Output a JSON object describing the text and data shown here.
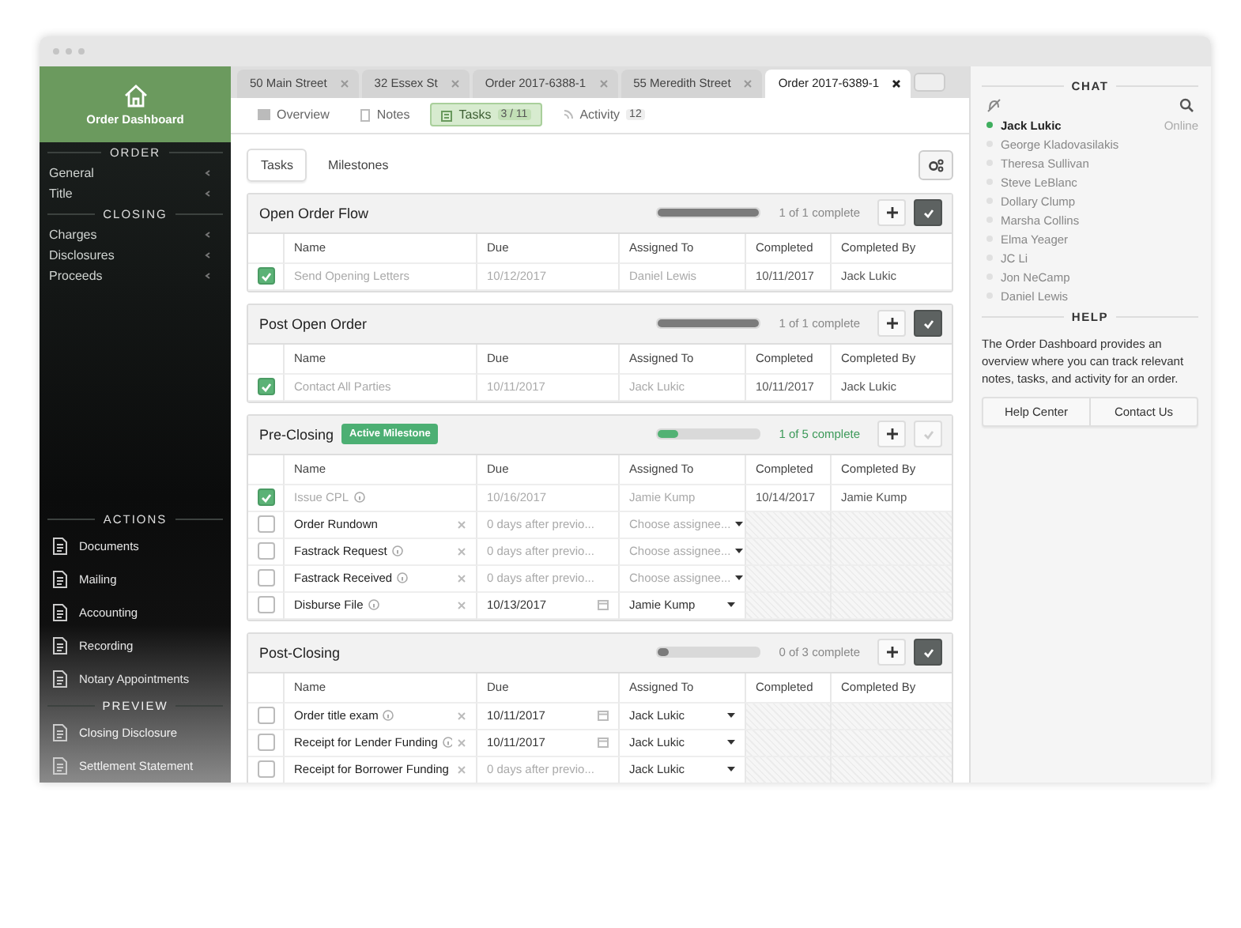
{
  "sidebar": {
    "title": "Order Dashboard",
    "groups": [
      {
        "heading": "ORDER",
        "items": [
          {
            "label": "General"
          },
          {
            "label": "Title"
          }
        ]
      },
      {
        "heading": "CLOSING",
        "items": [
          {
            "label": "Charges"
          },
          {
            "label": "Disclosures"
          },
          {
            "label": "Proceeds"
          }
        ]
      }
    ],
    "actions_heading": "ACTIONS",
    "actions": [
      {
        "label": "Documents"
      },
      {
        "label": "Mailing"
      },
      {
        "label": "Accounting"
      },
      {
        "label": "Recording"
      },
      {
        "label": "Notary Appointments"
      }
    ],
    "preview_heading": "PREVIEW",
    "preview": [
      {
        "label": "Closing Disclosure"
      },
      {
        "label": "Settlement Statement"
      }
    ]
  },
  "tabs": [
    {
      "label": "50 Main Street",
      "selected": false
    },
    {
      "label": "32 Essex St",
      "selected": false
    },
    {
      "label": "Order 2017-6388-1",
      "selected": false
    },
    {
      "label": "55 Meredith Street",
      "selected": false
    },
    {
      "label": "Order 2017-6389-1",
      "selected": true
    }
  ],
  "subtabs": [
    {
      "label": "Overview",
      "selected": false
    },
    {
      "label": "Notes",
      "selected": false
    },
    {
      "label": "Tasks",
      "count": "3 / 11",
      "selected": true
    },
    {
      "label": "Activity",
      "count": "12",
      "selected": false
    }
  ],
  "view_toggle": [
    {
      "label": "Tasks",
      "selected": true
    },
    {
      "label": "Milestones",
      "selected": false
    }
  ],
  "sections": [
    {
      "title": "Open Order Flow",
      "active": false,
      "level": 1,
      "progress_text": "1 of 1 complete",
      "check_enabled": true,
      "columns": [
        "Name",
        "Due",
        "Assigned To",
        "Completed",
        "Completed By"
      ],
      "rows": [
        {
          "kind": "done",
          "checked": true,
          "name": "Send Opening Letters",
          "info": false,
          "due": "10/12/2017",
          "assigned": "Daniel Lewis",
          "completed": "10/11/2017",
          "completed_by": "Jack Lukic"
        }
      ]
    },
    {
      "title": "Post Open Order",
      "active": false,
      "level": 1,
      "progress_text": "1 of 1 complete",
      "check_enabled": true,
      "columns": [
        "Name",
        "Due",
        "Assigned To",
        "Completed",
        "Completed By"
      ],
      "rows": [
        {
          "kind": "done",
          "checked": true,
          "name": "Contact All Parties",
          "info": false,
          "due": "10/11/2017",
          "assigned": "Jack Lukic",
          "completed": "10/11/2017",
          "completed_by": "Jack Lukic"
        }
      ]
    },
    {
      "title": "Pre-Closing",
      "badge": "Active Milestone",
      "active": true,
      "level": 0.2,
      "progress_text": "1 of 5 complete",
      "check_enabled": false,
      "columns": [
        "Name",
        "Due",
        "Assigned To",
        "Completed",
        "Completed By"
      ],
      "rows": [
        {
          "kind": "done",
          "checked": true,
          "name": "Issue CPL",
          "info": true,
          "due": "10/16/2017",
          "assigned": "Jamie Kump",
          "completed": "10/14/2017",
          "completed_by": "Jamie Kump"
        },
        {
          "kind": "edit",
          "checked": false,
          "name": "Order Rundown",
          "info": false,
          "due": {
            "placeholder": "0 days after previo..."
          },
          "assigned": {
            "placeholder": "Choose assignee..."
          }
        },
        {
          "kind": "edit",
          "checked": false,
          "name": "Fastrack Request",
          "info": true,
          "due": {
            "placeholder": "0 days after previo..."
          },
          "assigned": {
            "placeholder": "Choose assignee..."
          }
        },
        {
          "kind": "edit",
          "checked": false,
          "name": "Fastrack Received",
          "info": true,
          "due": {
            "placeholder": "0 days after previo..."
          },
          "assigned": {
            "placeholder": "Choose assignee..."
          }
        },
        {
          "kind": "edit",
          "checked": false,
          "name": "Disburse File",
          "info": true,
          "due": {
            "value": "10/13/2017"
          },
          "assigned": {
            "value": "Jamie Kump"
          }
        }
      ]
    },
    {
      "title": "Post-Closing",
      "active": false,
      "level": 0,
      "progress_text": "0 of 3 complete",
      "check_enabled": true,
      "columns": [
        "Name",
        "Due",
        "Assigned To",
        "Completed",
        "Completed By"
      ],
      "rows": [
        {
          "kind": "edit",
          "checked": false,
          "name": "Order title exam",
          "info": true,
          "due": {
            "value": "10/11/2017"
          },
          "assigned": {
            "value": "Jack Lukic"
          }
        },
        {
          "kind": "edit",
          "checked": false,
          "name": "Receipt for Lender Funding",
          "info": true,
          "due": {
            "value": "10/11/2017"
          },
          "assigned": {
            "value": "Jack Lukic"
          }
        },
        {
          "kind": "edit",
          "checked": false,
          "name": "Receipt for Borrower Funding",
          "info": false,
          "due": {
            "placeholder": "0 days after previo..."
          },
          "assigned": {
            "value": "Jack Lukic"
          }
        }
      ]
    }
  ],
  "chat": {
    "heading": "CHAT",
    "users": [
      {
        "name": "Jack Lukic",
        "online": true,
        "status": "Online"
      },
      {
        "name": "George Kladovasilakis",
        "online": false
      },
      {
        "name": "Theresa Sullivan",
        "online": false
      },
      {
        "name": "Steve LeBlanc",
        "online": false
      },
      {
        "name": "Dollary Clump",
        "online": false
      },
      {
        "name": "Marsha Collins",
        "online": false
      },
      {
        "name": "Elma Yeager",
        "online": false
      },
      {
        "name": "JC Li",
        "online": false
      },
      {
        "name": "Jon NeCamp",
        "online": false
      },
      {
        "name": "Daniel Lewis",
        "online": false
      }
    ]
  },
  "help": {
    "heading": "HELP",
    "text": "The Order Dashboard provides an overview where you can track relevant notes, tasks, and activity for an order.",
    "buttons": [
      "Help Center",
      "Contact Us"
    ]
  }
}
